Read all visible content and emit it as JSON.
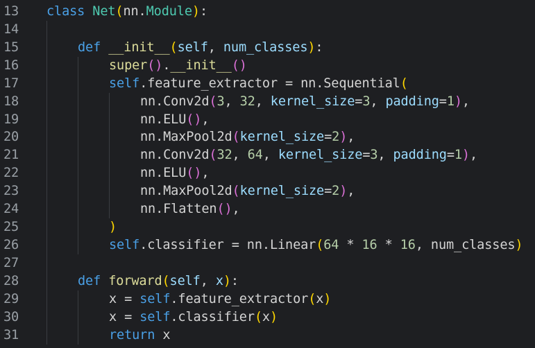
{
  "editor": {
    "language": "python",
    "theme_colors": {
      "background": "#1e1f22",
      "line_number": "#9aa0a6",
      "keyword": "#4aa0e6",
      "class_name": "#4ec9b0",
      "function": "#dcdc9a",
      "parameter": "#9cdcfe",
      "number": "#b5cea8",
      "bracket_level_1": "#ffd700",
      "bracket_level_2": "#da70d6",
      "text": "#d4d4d4"
    },
    "lines": [
      {
        "number": "13",
        "indent": 0,
        "tokens": [
          {
            "t": "class",
            "k": "kw"
          },
          {
            "t": " ",
            "k": "plain"
          },
          {
            "t": "Net",
            "k": "cls"
          },
          {
            "t": "(",
            "k": "p1"
          },
          {
            "t": "nn.",
            "k": "plain"
          },
          {
            "t": "Module",
            "k": "cls"
          },
          {
            "t": ")",
            "k": "p1"
          },
          {
            "t": ":",
            "k": "plain"
          }
        ]
      },
      {
        "number": "14",
        "indent": 0,
        "tokens": []
      },
      {
        "number": "15",
        "indent": 1,
        "tokens": [
          {
            "t": "def",
            "k": "kw"
          },
          {
            "t": " ",
            "k": "plain"
          },
          {
            "t": "__init__",
            "k": "fn"
          },
          {
            "t": "(",
            "k": "p1"
          },
          {
            "t": "self",
            "k": "param"
          },
          {
            "t": ", ",
            "k": "plain"
          },
          {
            "t": "num_classes",
            "k": "param"
          },
          {
            "t": ")",
            "k": "p1"
          },
          {
            "t": ":",
            "k": "plain"
          }
        ]
      },
      {
        "number": "16",
        "indent": 2,
        "tokens": [
          {
            "t": "super",
            "k": "fn"
          },
          {
            "t": "(",
            "k": "p2"
          },
          {
            "t": ")",
            "k": "p2"
          },
          {
            "t": ".",
            "k": "plain"
          },
          {
            "t": "__init__",
            "k": "fn"
          },
          {
            "t": "()",
            "k": "p2"
          }
        ]
      },
      {
        "number": "17",
        "indent": 2,
        "tokens": [
          {
            "t": "self",
            "k": "kw"
          },
          {
            "t": ".feature_extractor = nn.Sequential",
            "k": "plain"
          },
          {
            "t": "(",
            "k": "p1"
          }
        ]
      },
      {
        "number": "18",
        "indent": 3,
        "tokens": [
          {
            "t": "nn.Conv2d",
            "k": "plain"
          },
          {
            "t": "(",
            "k": "p2"
          },
          {
            "t": "3",
            "k": "num"
          },
          {
            "t": ", ",
            "k": "plain"
          },
          {
            "t": "32",
            "k": "num"
          },
          {
            "t": ", ",
            "k": "plain"
          },
          {
            "t": "kernel_size",
            "k": "param"
          },
          {
            "t": "=",
            "k": "plain"
          },
          {
            "t": "3",
            "k": "num"
          },
          {
            "t": ", ",
            "k": "plain"
          },
          {
            "t": "padding",
            "k": "param"
          },
          {
            "t": "=",
            "k": "plain"
          },
          {
            "t": "1",
            "k": "num"
          },
          {
            "t": ")",
            "k": "p2"
          },
          {
            "t": ",",
            "k": "plain"
          }
        ]
      },
      {
        "number": "19",
        "indent": 3,
        "tokens": [
          {
            "t": "nn.ELU",
            "k": "plain"
          },
          {
            "t": "()",
            "k": "p2"
          },
          {
            "t": ",",
            "k": "plain"
          }
        ]
      },
      {
        "number": "20",
        "indent": 3,
        "tokens": [
          {
            "t": "nn.MaxPool2d",
            "k": "plain"
          },
          {
            "t": "(",
            "k": "p2"
          },
          {
            "t": "kernel_size",
            "k": "param"
          },
          {
            "t": "=",
            "k": "plain"
          },
          {
            "t": "2",
            "k": "num"
          },
          {
            "t": ")",
            "k": "p2"
          },
          {
            "t": ",",
            "k": "plain"
          }
        ]
      },
      {
        "number": "21",
        "indent": 3,
        "tokens": [
          {
            "t": "nn.Conv2d",
            "k": "plain"
          },
          {
            "t": "(",
            "k": "p2"
          },
          {
            "t": "32",
            "k": "num"
          },
          {
            "t": ", ",
            "k": "plain"
          },
          {
            "t": "64",
            "k": "num"
          },
          {
            "t": ", ",
            "k": "plain"
          },
          {
            "t": "kernel_size",
            "k": "param"
          },
          {
            "t": "=",
            "k": "plain"
          },
          {
            "t": "3",
            "k": "num"
          },
          {
            "t": ", ",
            "k": "plain"
          },
          {
            "t": "padding",
            "k": "param"
          },
          {
            "t": "=",
            "k": "plain"
          },
          {
            "t": "1",
            "k": "num"
          },
          {
            "t": ")",
            "k": "p2"
          },
          {
            "t": ",",
            "k": "plain"
          }
        ]
      },
      {
        "number": "22",
        "indent": 3,
        "tokens": [
          {
            "t": "nn.ELU",
            "k": "plain"
          },
          {
            "t": "()",
            "k": "p2"
          },
          {
            "t": ",",
            "k": "plain"
          }
        ]
      },
      {
        "number": "23",
        "indent": 3,
        "tokens": [
          {
            "t": "nn.MaxPool2d",
            "k": "plain"
          },
          {
            "t": "(",
            "k": "p2"
          },
          {
            "t": "kernel_size",
            "k": "param"
          },
          {
            "t": "=",
            "k": "plain"
          },
          {
            "t": "2",
            "k": "num"
          },
          {
            "t": ")",
            "k": "p2"
          },
          {
            "t": ",",
            "k": "plain"
          }
        ]
      },
      {
        "number": "24",
        "indent": 3,
        "tokens": [
          {
            "t": "nn.Flatten",
            "k": "plain"
          },
          {
            "t": "()",
            "k": "p2"
          },
          {
            "t": ",",
            "k": "plain"
          }
        ]
      },
      {
        "number": "25",
        "indent": 2,
        "tokens": [
          {
            "t": ")",
            "k": "p1"
          }
        ]
      },
      {
        "number": "26",
        "indent": 2,
        "tokens": [
          {
            "t": "self",
            "k": "kw"
          },
          {
            "t": ".classifier = nn.Linear",
            "k": "plain"
          },
          {
            "t": "(",
            "k": "p1"
          },
          {
            "t": "64",
            "k": "num"
          },
          {
            "t": " * ",
            "k": "plain"
          },
          {
            "t": "16",
            "k": "num"
          },
          {
            "t": " * ",
            "k": "plain"
          },
          {
            "t": "16",
            "k": "num"
          },
          {
            "t": ", num_classes",
            "k": "plain"
          },
          {
            "t": ")",
            "k": "p1"
          }
        ]
      },
      {
        "number": "27",
        "indent": 0,
        "tokens": []
      },
      {
        "number": "28",
        "indent": 1,
        "tokens": [
          {
            "t": "def",
            "k": "kw"
          },
          {
            "t": " ",
            "k": "plain"
          },
          {
            "t": "forward",
            "k": "fn"
          },
          {
            "t": "(",
            "k": "p1"
          },
          {
            "t": "self",
            "k": "param"
          },
          {
            "t": ", ",
            "k": "plain"
          },
          {
            "t": "x",
            "k": "param"
          },
          {
            "t": ")",
            "k": "p1"
          },
          {
            "t": ":",
            "k": "plain"
          }
        ]
      },
      {
        "number": "29",
        "indent": 2,
        "tokens": [
          {
            "t": "x = ",
            "k": "plain"
          },
          {
            "t": "self",
            "k": "kw"
          },
          {
            "t": ".feature_extractor",
            "k": "plain"
          },
          {
            "t": "(",
            "k": "p1"
          },
          {
            "t": "x",
            "k": "plain"
          },
          {
            "t": ")",
            "k": "p1"
          }
        ]
      },
      {
        "number": "30",
        "indent": 2,
        "tokens": [
          {
            "t": "x = ",
            "k": "plain"
          },
          {
            "t": "self",
            "k": "kw"
          },
          {
            "t": ".classifier",
            "k": "plain"
          },
          {
            "t": "(",
            "k": "p1"
          },
          {
            "t": "x",
            "k": "plain"
          },
          {
            "t": ")",
            "k": "p1"
          }
        ]
      },
      {
        "number": "31",
        "indent": 2,
        "tokens": [
          {
            "t": "return",
            "k": "kw"
          },
          {
            "t": " x",
            "k": "plain"
          }
        ]
      }
    ]
  }
}
